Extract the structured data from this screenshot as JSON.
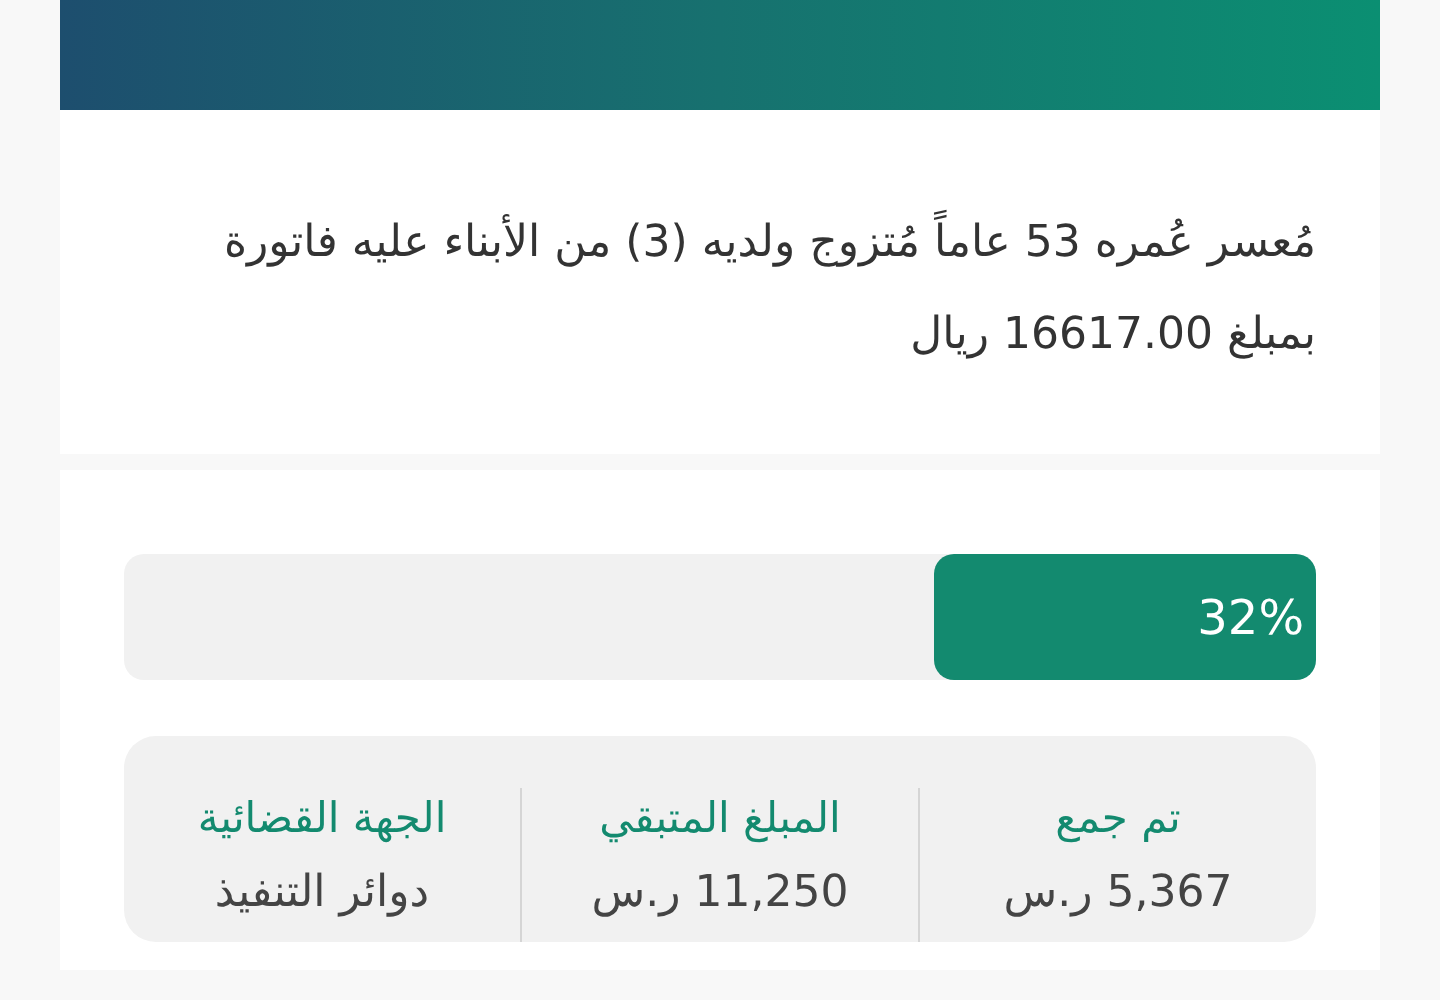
{
  "description": "مُعسر عُمره 53 عاماً مُتزوج ولديه (3) من الأبناء عليه فاتورة بمبلغ 16617.00 ريال",
  "progress": {
    "level": 0.32,
    "reading": "32%"
  },
  "stats": [
    {
      "label": "تم جمع",
      "value": "5,367",
      "unit": "ر.س"
    },
    {
      "label": "المبلغ المتبقي",
      "value": "11,250",
      "unit": "ر.س"
    },
    {
      "label": "الجهة القضائية",
      "value": "دوائر التنفيذ"
    }
  ]
}
